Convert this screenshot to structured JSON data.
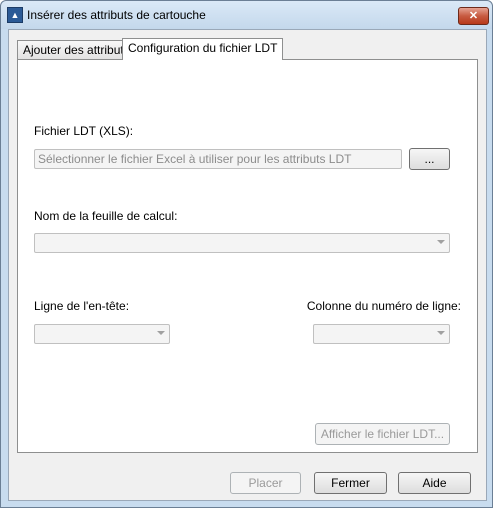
{
  "window": {
    "title": "Insérer des attributs de cartouche",
    "close_glyph": "✕",
    "app_icon": "autocad-icon"
  },
  "tabs": [
    {
      "label": "Ajouter des attributs",
      "active": false
    },
    {
      "label": "Configuration du fichier LDT",
      "active": true
    }
  ],
  "ldt_file": {
    "label": "Fichier LDT (XLS):",
    "placeholder": "Sélectionner le fichier Excel à utiliser pour les attributs LDT",
    "browse_label": "..."
  },
  "sheet": {
    "label": "Nom de la feuille de calcul:",
    "value": ""
  },
  "header_row": {
    "label": "Ligne de l'en-tête:",
    "value": ""
  },
  "row_number_column": {
    "label": "Colonne du numéro de ligne:",
    "value": ""
  },
  "show_ldt_button": "Afficher le fichier LDT...",
  "footer": {
    "place_label": "Placer",
    "close_label": "Fermer",
    "help_label": "Aide"
  }
}
